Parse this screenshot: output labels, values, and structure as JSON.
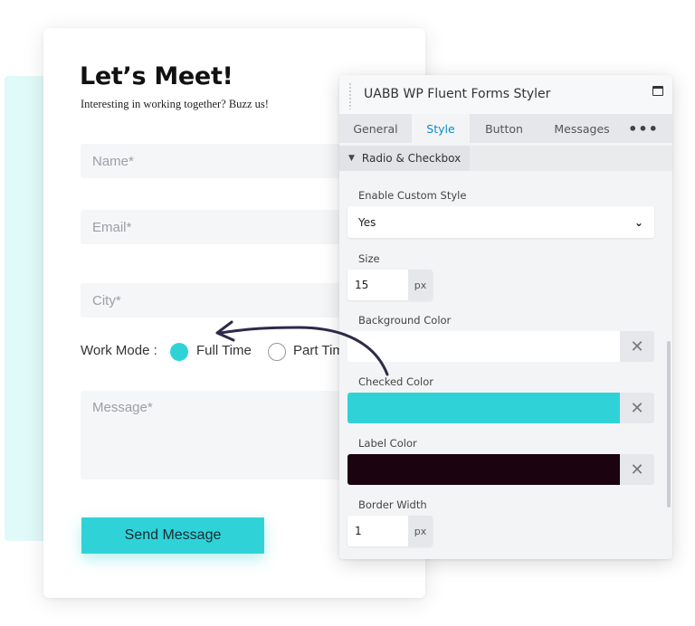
{
  "form": {
    "title": "Let’s Meet!",
    "subtitle": "Interesting in working together? Buzz us!",
    "name_placeholder": "Name*",
    "email_placeholder": "Email*",
    "city_placeholder": "City*",
    "work_mode_label": "Work Mode :",
    "options": [
      "Full Time",
      "Part Tim"
    ],
    "selected_option": "Full Time",
    "message_placeholder": "Message*",
    "submit_label": "Send Message"
  },
  "panel": {
    "title": "UABB WP Fluent Forms Styler",
    "tabs": [
      "General",
      "Style",
      "Button",
      "Messages",
      "•••"
    ],
    "active_tab": "Style",
    "section": "Radio & Checkbox",
    "settings": {
      "enable_custom_style": {
        "label": "Enable Custom Style",
        "value": "Yes"
      },
      "size": {
        "label": "Size",
        "value": "15",
        "unit": "px"
      },
      "background_color": {
        "label": "Background Color",
        "value": "#ffffff"
      },
      "checked_color": {
        "label": "Checked Color",
        "value": "#2fd3d7"
      },
      "label_color": {
        "label": "Label Color",
        "value": "#1b0310"
      },
      "border_width": {
        "label": "Border Width",
        "value": "1",
        "unit": "px"
      }
    }
  },
  "colors": {
    "accent": "#2fd3d7",
    "link_blue": "#0b8ec2",
    "arrow": "#2d2a4a"
  },
  "icons": {
    "minimize": "window-minimize-icon",
    "section_toggle": "chevron-down-icon",
    "select_toggle": "chevron-down-icon",
    "clear": "close-icon",
    "more": "more-horizontal-icon"
  }
}
